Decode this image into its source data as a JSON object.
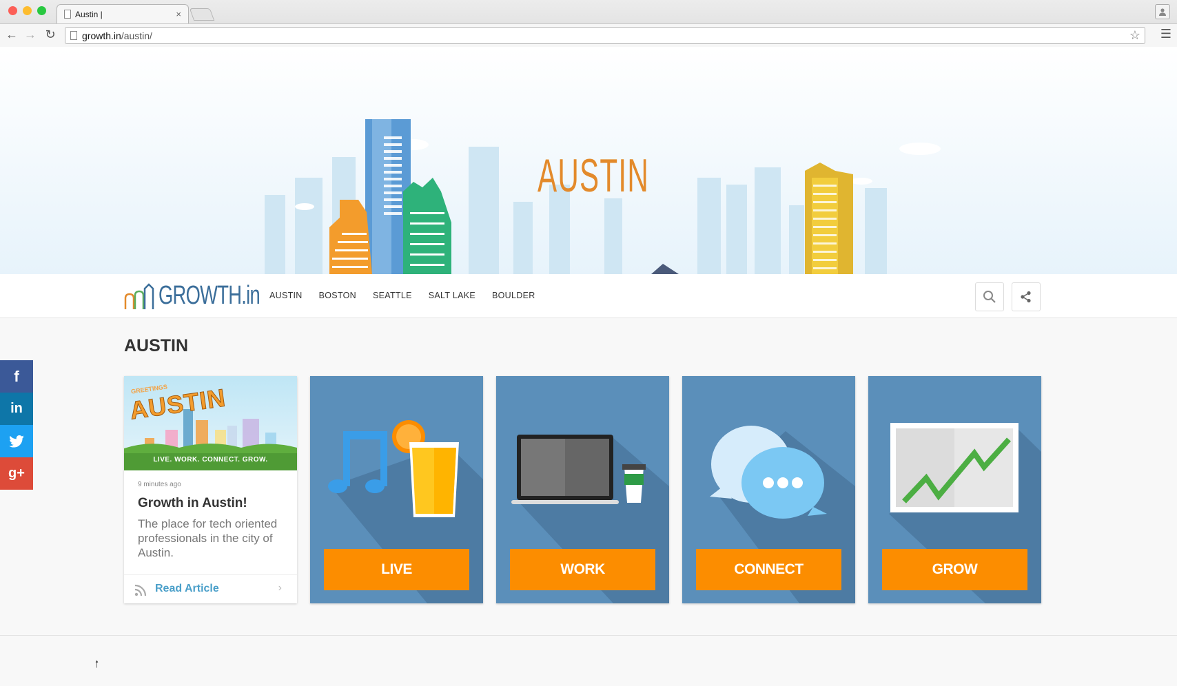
{
  "browser": {
    "tab_title": "Austin |",
    "tab_close": "×",
    "url_host": "growth.in",
    "url_path": "/austin/"
  },
  "hero": {
    "title": "AUSTIN"
  },
  "nav": {
    "logo_text": "GROWTH.in",
    "links": [
      "AUSTIN",
      "BOSTON",
      "SEATTLE",
      "SALT LAKE",
      "BOULDER"
    ]
  },
  "page": {
    "heading": "AUSTIN"
  },
  "social": {
    "icons": [
      "facebook-icon",
      "linkedin-icon",
      "twitter-icon",
      "google-plus-icon"
    ],
    "colors": [
      "#3b5998",
      "#0e76a8",
      "#1da1f2",
      "#dd4b39"
    ],
    "labels": [
      "f",
      "in",
      "",
      "g+"
    ]
  },
  "article": {
    "thumb_greeting": "GREETINGS",
    "thumb_city": "AUSTIN",
    "thumb_banner": "LIVE. WORK. CONNECT. GROW.",
    "time": "9 minutes ago",
    "title": "Growth in Austin!",
    "excerpt": "The place for tech oriented professionals in the city of Austin.",
    "read_more": "Read Article"
  },
  "tiles": [
    {
      "label": "LIVE"
    },
    {
      "label": "WORK"
    },
    {
      "label": "CONNECT"
    },
    {
      "label": "GROW"
    }
  ],
  "colors": {
    "accent": "#fc8d00",
    "tile_bg": "#5b8fba",
    "title_orange": "#e38a2b",
    "logo_blue": "#3b6e9a"
  }
}
